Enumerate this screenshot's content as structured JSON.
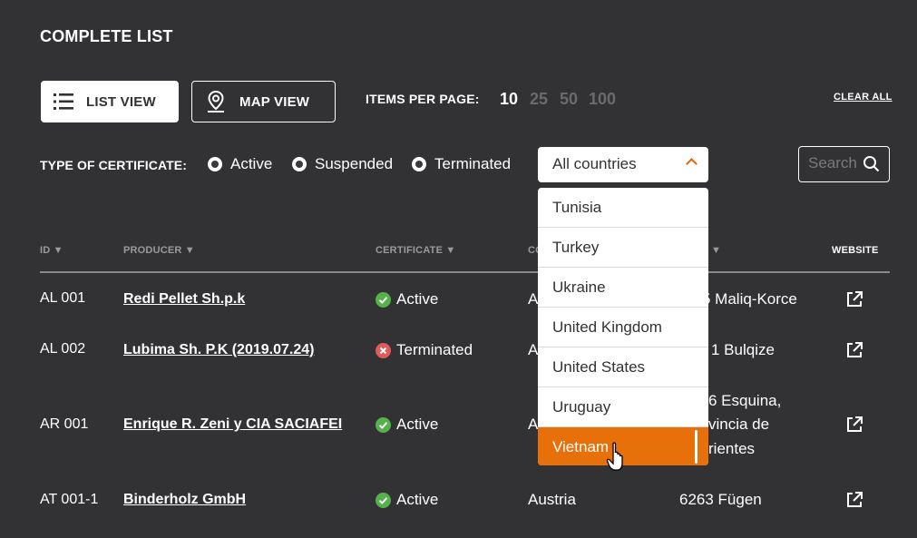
{
  "title": "COMPLETE LIST",
  "view": {
    "list_label": "LIST VIEW",
    "map_label": "MAP VIEW"
  },
  "items_per_page": {
    "label": "ITEMS PER PAGE:",
    "options": [
      "10",
      "25",
      "50",
      "100"
    ],
    "selected": "10"
  },
  "clear_all": "CLEAR ALL",
  "filter": {
    "label": "TYPE OF CERTIFICATE:",
    "options": [
      "Active",
      "Suspended",
      "Terminated"
    ],
    "country_select": "All countries",
    "search_placeholder": "Search"
  },
  "table": {
    "headers": {
      "id": "ID ▼",
      "producer": "PRODUCER ▼",
      "certificate": "CERTIFICATE ▼",
      "country": "CO",
      "address": "▼",
      "website": "WEBSITE"
    },
    "rows": [
      {
        "id": "AL 001",
        "producer": "Redi Pellet Sh.p.k",
        "certificate": "Active",
        "country": "A",
        "address": "5 Maliq-Korce"
      },
      {
        "id": "AL 002",
        "producer": "Lubima Sh. P.K (2019.07.24)",
        "certificate": "Terminated",
        "country": "A",
        "address": "1 Bulqize"
      },
      {
        "id": "AR 001",
        "producer": "Enrique R. Zeni y CIA SACIAFEI",
        "certificate": "Active",
        "country": "A",
        "address_lines": [
          "6 Esquina,",
          "vincia de",
          "rientes"
        ]
      },
      {
        "id": "AT 001-1",
        "producer": "Binderholz GmbH",
        "certificate": "Active",
        "country": "Austria",
        "address": "6263 Fügen"
      }
    ]
  },
  "dropdown": {
    "items": [
      "Tunisia",
      "Turkey",
      "Ukraine",
      "United Kingdom",
      "United States",
      "Uruguay",
      "Vietnam"
    ],
    "highlighted": "Vietnam"
  },
  "colors": {
    "background": "#323235",
    "accent": "#e8700a",
    "active": "#55b24a",
    "terminated": "#e05a5a"
  },
  "icons": {
    "list": "list-icon",
    "map": "map-pin-icon",
    "search": "search-icon",
    "external": "external-link-icon",
    "caret": "chevron-up-icon"
  }
}
